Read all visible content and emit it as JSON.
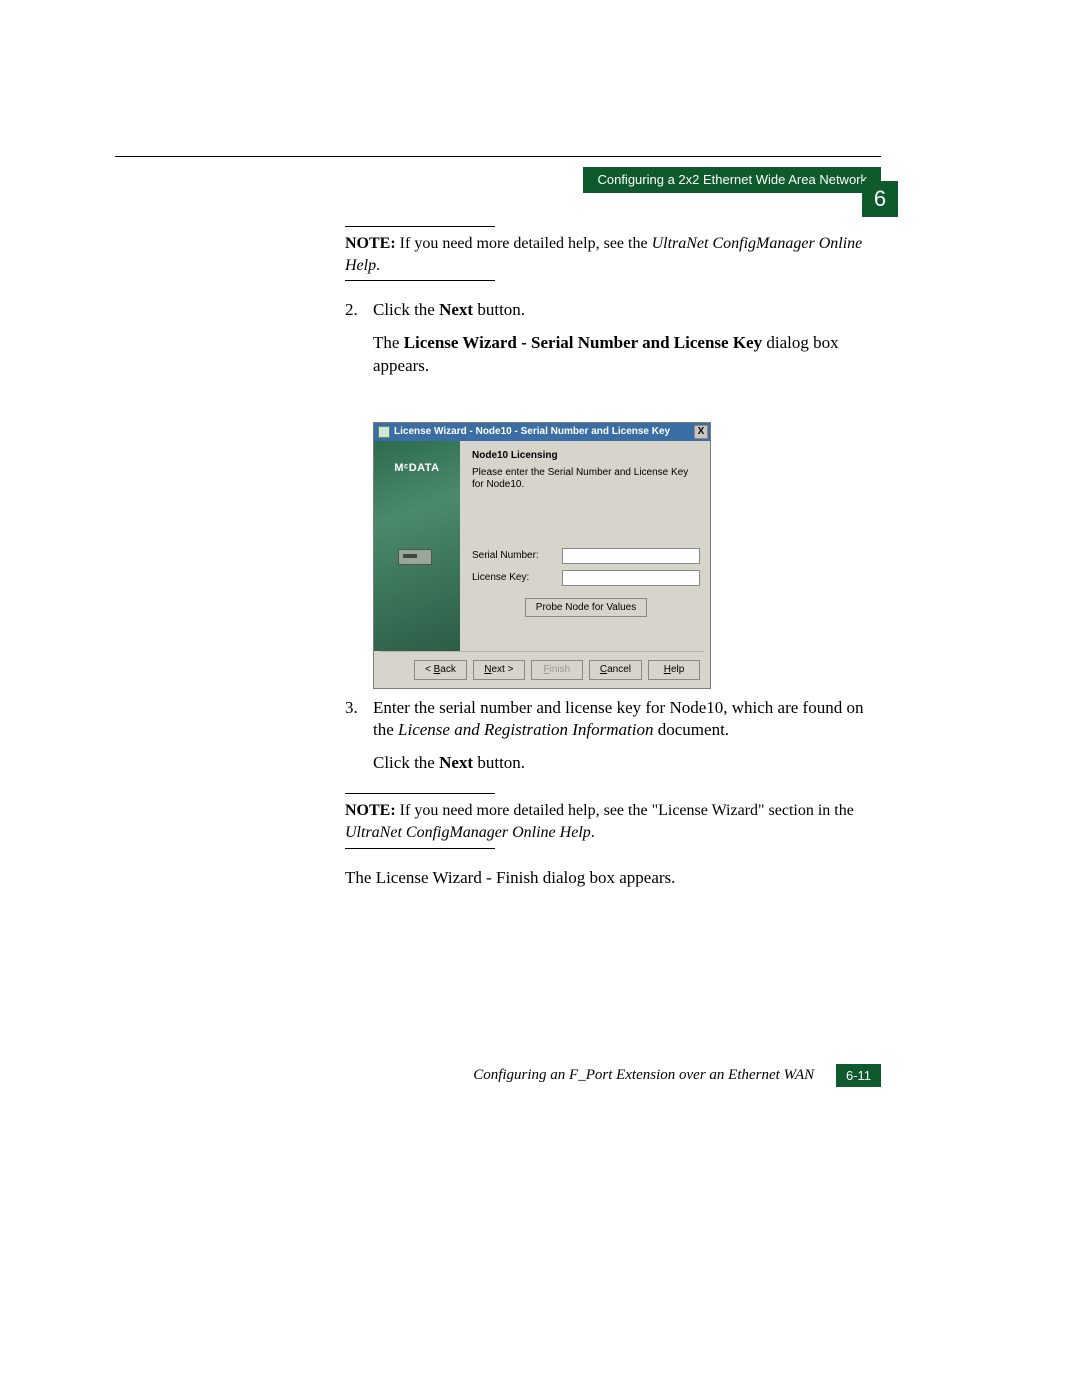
{
  "header": {
    "section_title": "Configuring a 2x2 Ethernet Wide Area Network",
    "chapter_number": "6"
  },
  "note1": {
    "label": "NOTE:",
    "text_before": " If you need more detailed help, see the ",
    "italic": "UltraNet ConfigManager Online Help",
    "text_after": "."
  },
  "step2": {
    "num": "2.",
    "line1_a": "Click the ",
    "line1_bold": "Next",
    "line1_b": " button.",
    "line2_a": "The ",
    "line2_bold": "License Wizard - Serial Number and License Key",
    "line2_b": " dialog box appears."
  },
  "dialog": {
    "title": "License Wizard - Node10 - Serial Number and License Key",
    "logo": "MᶜDATA",
    "subtitle": "Node10 Licensing",
    "description": "Please enter the Serial Number and License Key for Node10.",
    "serial_label": "Serial Number:",
    "key_label": "License Key:",
    "probe_label": "Probe Node for Values",
    "back": "< Back",
    "next": "Next >",
    "finish": "Finish",
    "cancel": "Cancel",
    "help": "Help",
    "close_x": "X"
  },
  "step3": {
    "num": "3.",
    "line1_a": "Enter the serial number and license key for Node10, which are found on the ",
    "line1_italic": "License and Registration Information",
    "line1_b": " document.",
    "line2_a": "Click the ",
    "line2_bold": "Next",
    "line2_b": " button."
  },
  "note2": {
    "label": "NOTE:",
    "text_before": " If you need more detailed help, see the \"License Wizard\" section in the ",
    "italic": "UltraNet ConfigManager Online Help",
    "text_after": "."
  },
  "closing": {
    "a": "The ",
    "bold": "License Wizard - Finish",
    "b": " dialog box appears."
  },
  "footer": {
    "text": "Configuring an F_Port Extension over an Ethernet WAN",
    "page": "6-11"
  }
}
